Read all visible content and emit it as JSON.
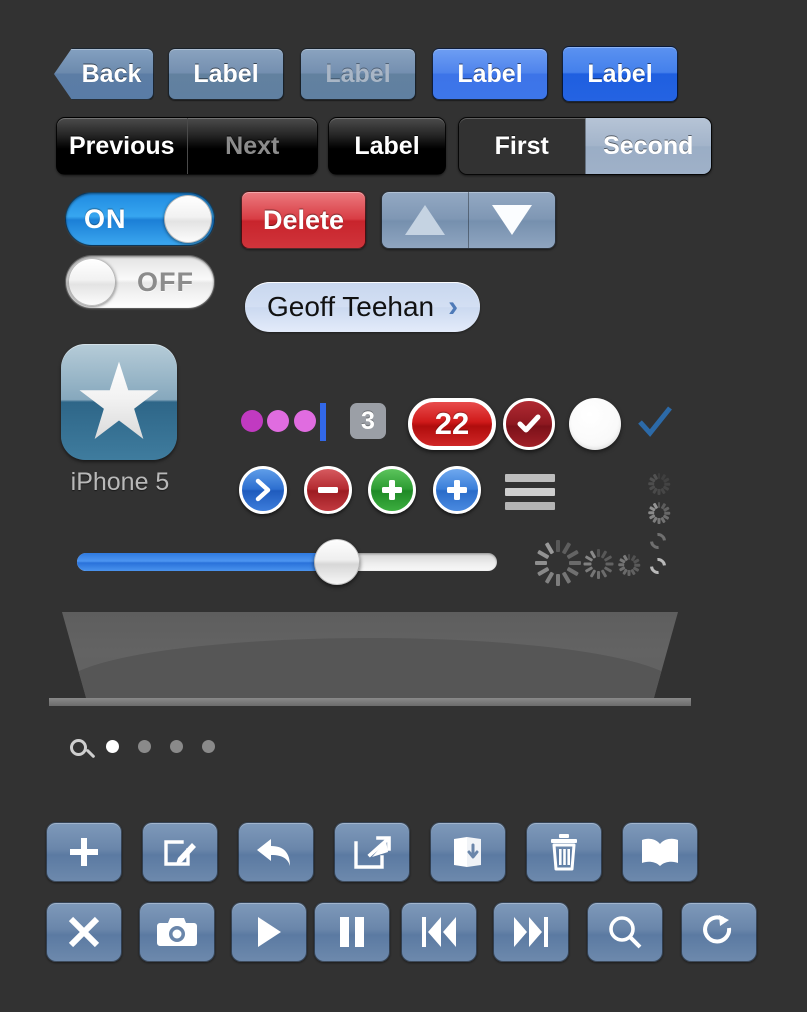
{
  "meta": {
    "title": "iOS UI Kit Mockup",
    "background_color": "#323232"
  },
  "nav_buttons": {
    "items": [
      {
        "label": "Back",
        "name": "back-button",
        "style": "back"
      },
      {
        "label": "Label",
        "name": "nav-button-label-1",
        "style": "gray"
      },
      {
        "label": "Label",
        "name": "nav-button-label-2",
        "style": "gray-dim"
      },
      {
        "label": "Label",
        "name": "nav-button-label-3",
        "style": "blue"
      },
      {
        "label": "Label",
        "name": "nav-button-label-4",
        "style": "blue-active"
      }
    ]
  },
  "segmented_controls": [
    {
      "name": "segmented-prev-next",
      "style": "dark",
      "segments": [
        {
          "label": "Previous",
          "selected": true
        },
        {
          "label": "Next",
          "selected": false
        }
      ]
    },
    {
      "name": "segmented-label",
      "style": "dark",
      "segments": [
        {
          "label": "Label",
          "selected": true
        }
      ]
    },
    {
      "name": "segmented-first-second",
      "style": "blue",
      "segments": [
        {
          "label": "First",
          "selected": false
        },
        {
          "label": "Second",
          "selected": true
        }
      ]
    }
  ],
  "switches": [
    {
      "name": "switch-on",
      "label": "ON",
      "state": "on"
    },
    {
      "name": "switch-off",
      "label": "OFF",
      "state": "off"
    }
  ],
  "delete_button": {
    "label": "Delete",
    "color": "#d0343b"
  },
  "stepper": {
    "name": "stepper-control",
    "up_icon": "triangle-up-icon",
    "down_icon": "triangle-down-icon"
  },
  "contact_pill": {
    "name": "contact-pill",
    "label": "Geoff Teehan",
    "chevron": "›"
  },
  "app_icon": {
    "name": "app-icon-star",
    "label": "iPhone 5",
    "glyph": "star-icon"
  },
  "indicators": {
    "typing_dots": [
      {
        "color": "#c13ac1"
      },
      {
        "color": "#e06ce0"
      },
      {
        "color": "#e06ce0"
      }
    ],
    "caret_color": "#3268e8",
    "badge_gray": {
      "value": "3",
      "color": "#9b9fa6"
    },
    "badge_red": {
      "value": "22",
      "color": "#d01a1a"
    },
    "check_circle": {
      "name": "check-circle-icon",
      "color": "#8e1820"
    },
    "white_circle": {
      "name": "empty-circle-icon",
      "color": "#ffffff"
    },
    "blue_check": {
      "name": "checkmark-icon",
      "color": "#2c6aa8"
    }
  },
  "round_buttons": [
    {
      "name": "disclosure-chevron-button",
      "glyph": "chevron-right-icon",
      "color": "#2d6fd0"
    },
    {
      "name": "remove-button",
      "glyph": "minus-icon",
      "color": "#b32a30"
    },
    {
      "name": "add-green-button",
      "glyph": "plus-icon",
      "color": "#2d9c33"
    },
    {
      "name": "add-blue-button",
      "glyph": "plus-icon",
      "color": "#3a7fd9"
    }
  ],
  "reorder_handle": {
    "name": "reorder-handle-icon",
    "bars": 3
  },
  "slider": {
    "name": "volume-slider",
    "value_percent": 62,
    "fill_color": "#3a83e6",
    "track_color": "#eeeeee"
  },
  "activity_indicators": [
    {
      "name": "spinner-large",
      "size": "large",
      "style": "spokes"
    },
    {
      "name": "spinner-medium",
      "size": "medium",
      "style": "spokes"
    },
    {
      "name": "spinner-small",
      "size": "small",
      "style": "spokes"
    },
    {
      "name": "spinner-tiny-1",
      "size": "tiny",
      "style": "spokes"
    },
    {
      "name": "spinner-tiny-2",
      "size": "tiny",
      "style": "spokes"
    },
    {
      "name": "refresh-ring-dim",
      "style": "ring"
    },
    {
      "name": "refresh-ring-bright",
      "style": "ring"
    }
  ],
  "banner": {
    "name": "perspective-banner"
  },
  "page_control": {
    "name": "page-control",
    "search_icon": "search-icon",
    "total_pages": 4,
    "current_page": 1
  },
  "toolbar_rows": [
    {
      "name": "toolbar-row-1",
      "buttons": [
        {
          "name": "add-button",
          "icon": "plus-icon"
        },
        {
          "name": "compose-button",
          "icon": "compose-icon"
        },
        {
          "name": "reply-button",
          "icon": "reply-arrow-icon"
        },
        {
          "name": "share-button",
          "icon": "share-arrow-icon"
        },
        {
          "name": "file-save-button",
          "icon": "folder-download-icon"
        },
        {
          "name": "trash-button",
          "icon": "trash-icon"
        },
        {
          "name": "bookmarks-button",
          "icon": "book-icon"
        }
      ]
    },
    {
      "name": "toolbar-row-2",
      "buttons": [
        {
          "name": "close-button",
          "icon": "x-icon"
        },
        {
          "name": "camera-button",
          "icon": "camera-icon"
        },
        {
          "name": "play-button",
          "icon": "play-icon"
        },
        {
          "name": "pause-button",
          "icon": "pause-icon"
        },
        {
          "name": "rewind-button",
          "icon": "rewind-icon"
        },
        {
          "name": "fastforward-button",
          "icon": "fast-forward-icon"
        },
        {
          "name": "search-button",
          "icon": "search-magnifier-icon"
        },
        {
          "name": "refresh-button",
          "icon": "refresh-icon"
        }
      ]
    }
  ]
}
